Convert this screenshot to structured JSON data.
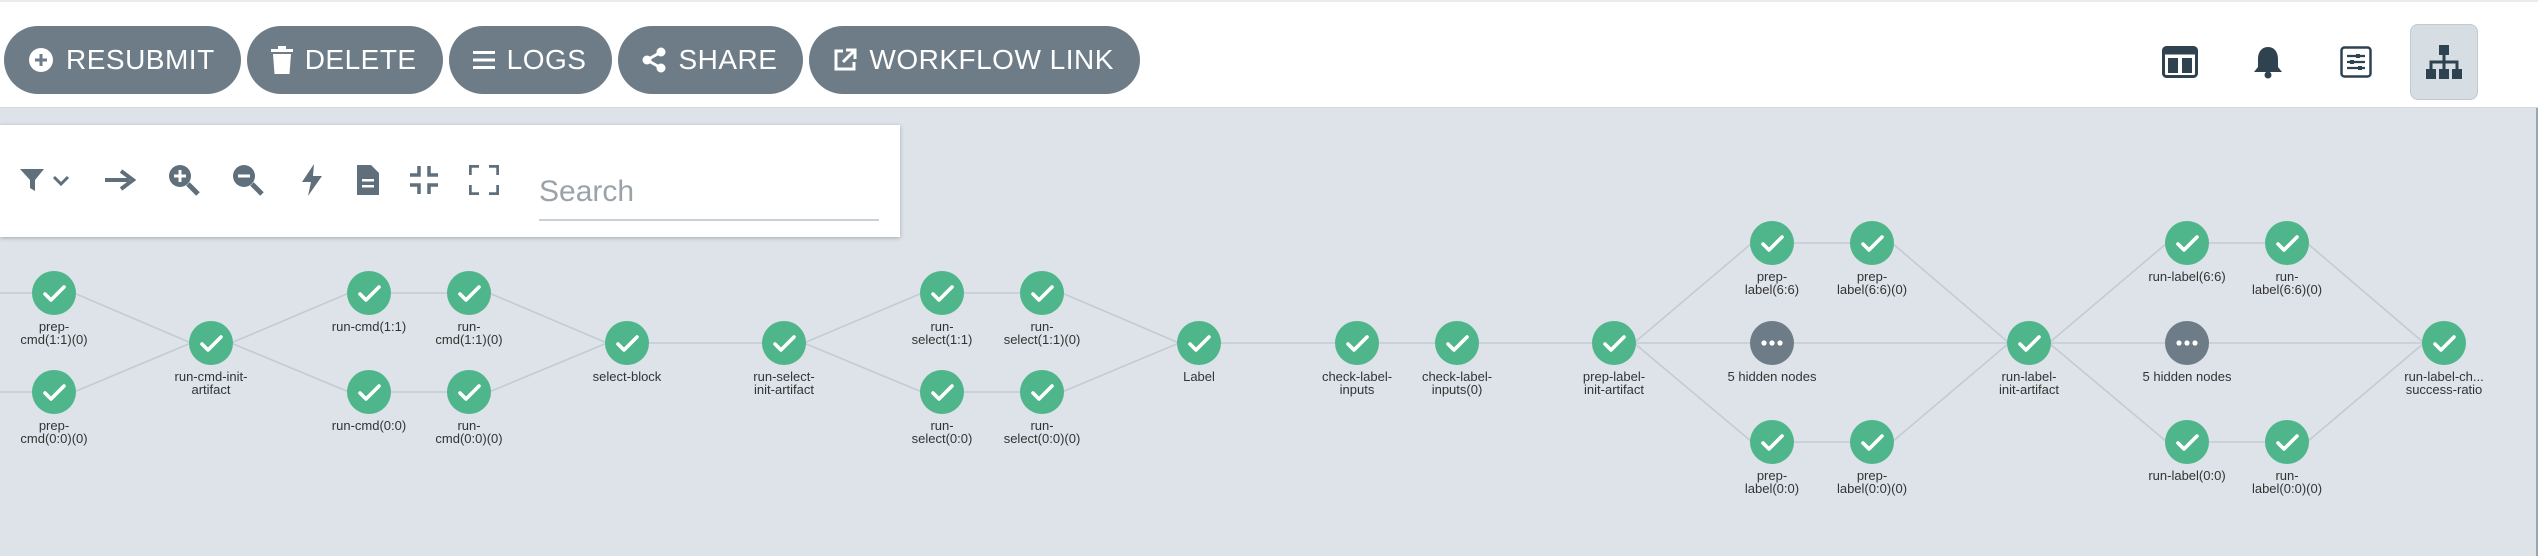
{
  "toolbar": {
    "buttons": [
      {
        "label": "RESUBMIT",
        "icon": "plus-circle-icon"
      },
      {
        "label": "DELETE",
        "icon": "trash-icon"
      },
      {
        "label": "LOGS",
        "icon": "list-icon"
      },
      {
        "label": "SHARE",
        "icon": "share-icon"
      },
      {
        "label": "WORKFLOW LINK",
        "icon": "external-link-icon"
      }
    ],
    "right_icons": [
      "split-panel-icon",
      "bell-icon",
      "settings-list-icon",
      "hierarchy-icon"
    ]
  },
  "graph_controls": {
    "icons": [
      "filter-icon",
      "arrow-right-icon",
      "zoom-in-icon",
      "zoom-out-icon",
      "lightning-icon",
      "document-icon",
      "collapse-icon",
      "expand-icon"
    ],
    "search_placeholder": "Search"
  },
  "colors": {
    "success": "#4fb58a",
    "hidden": "#6d7c87",
    "button": "#6d7c87",
    "canvas": "#dde3e8"
  },
  "nodes": [
    {
      "id": "n1",
      "lines": [
        "prep-",
        "cmd(1:1)(0)"
      ],
      "status": "success"
    },
    {
      "id": "n2",
      "lines": [
        "prep-",
        "cmd(0:0)(0)"
      ],
      "status": "success"
    },
    {
      "id": "n3",
      "lines": [
        "run-cmd-init-",
        "artifact"
      ],
      "status": "success"
    },
    {
      "id": "n4",
      "lines": [
        "run-cmd(1:1)"
      ],
      "status": "success"
    },
    {
      "id": "n5",
      "lines": [
        "run-",
        "cmd(1:1)(0)"
      ],
      "status": "success"
    },
    {
      "id": "n6",
      "lines": [
        "run-cmd(0:0)"
      ],
      "status": "success"
    },
    {
      "id": "n7",
      "lines": [
        "run-",
        "cmd(0:0)(0)"
      ],
      "status": "success"
    },
    {
      "id": "n8",
      "lines": [
        "select-block"
      ],
      "status": "success"
    },
    {
      "id": "n9",
      "lines": [
        "run-select-",
        "init-artifact"
      ],
      "status": "success"
    },
    {
      "id": "n10",
      "lines": [
        "run-",
        "select(1:1)"
      ],
      "status": "success"
    },
    {
      "id": "n11",
      "lines": [
        "run-",
        "select(1:1)(0)"
      ],
      "status": "success"
    },
    {
      "id": "n12",
      "lines": [
        "run-",
        "select(0:0)"
      ],
      "status": "success"
    },
    {
      "id": "n13",
      "lines": [
        "run-",
        "select(0:0)(0)"
      ],
      "status": "success"
    },
    {
      "id": "n14",
      "lines": [
        "Label"
      ],
      "status": "success"
    },
    {
      "id": "n15",
      "lines": [
        "check-label-",
        "inputs"
      ],
      "status": "success"
    },
    {
      "id": "n16",
      "lines": [
        "check-label-",
        "inputs(0)"
      ],
      "status": "success"
    },
    {
      "id": "n17",
      "lines": [
        "prep-label-",
        "init-artifact"
      ],
      "status": "success"
    },
    {
      "id": "n18",
      "lines": [
        "prep-",
        "label(6:6)"
      ],
      "status": "success"
    },
    {
      "id": "n19",
      "lines": [
        "prep-",
        "label(6:6)(0)"
      ],
      "status": "success"
    },
    {
      "id": "n20",
      "lines": [
        "5 hidden nodes"
      ],
      "status": "hidden"
    },
    {
      "id": "n21",
      "lines": [
        "prep-",
        "label(0:0)"
      ],
      "status": "success"
    },
    {
      "id": "n22",
      "lines": [
        "prep-",
        "label(0:0)(0)"
      ],
      "status": "success"
    },
    {
      "id": "n23",
      "lines": [
        "run-label-",
        "init-artifact"
      ],
      "status": "success"
    },
    {
      "id": "n24",
      "lines": [
        "run-label(6:6)"
      ],
      "status": "success"
    },
    {
      "id": "n25",
      "lines": [
        "run-",
        "label(6:6)(0)"
      ],
      "status": "success"
    },
    {
      "id": "n26",
      "lines": [
        "5 hidden nodes"
      ],
      "status": "hidden"
    },
    {
      "id": "n27",
      "lines": [
        "run-label(0:0)"
      ],
      "status": "success"
    },
    {
      "id": "n28",
      "lines": [
        "run-",
        "label(0:0)(0)"
      ],
      "status": "success"
    },
    {
      "id": "n29",
      "lines": [
        "run-label-ch...",
        "success-ratio"
      ],
      "status": "success"
    }
  ]
}
